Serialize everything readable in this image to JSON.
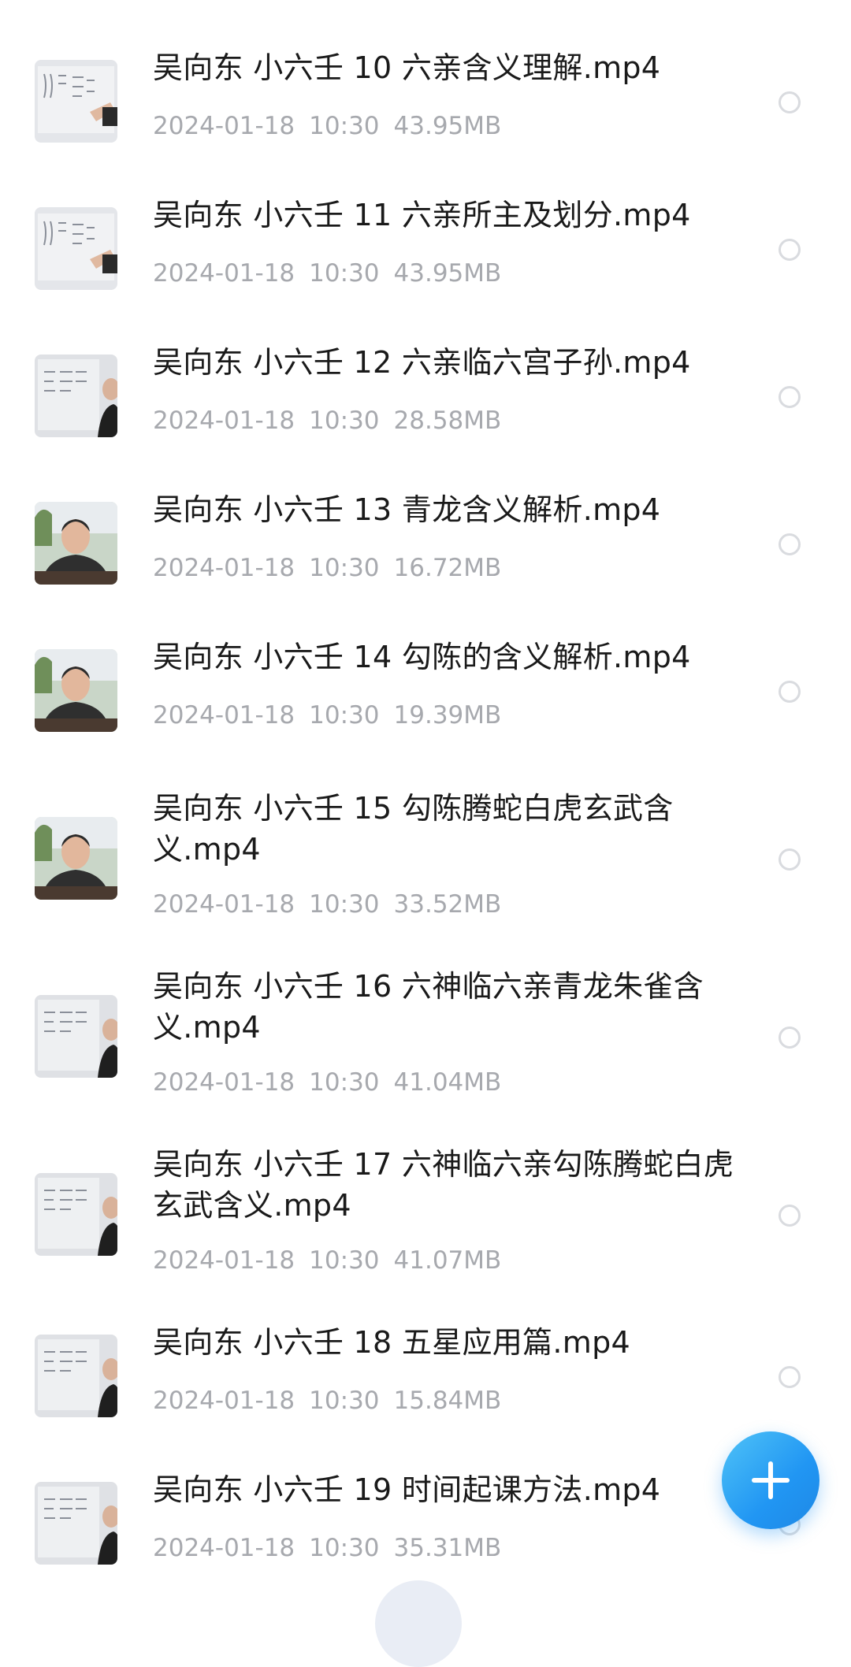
{
  "files": [
    {
      "name": "吴向东 小六壬 10 六亲含义理解.mp4",
      "date": "2024-01-18",
      "time": "10:30",
      "size": "43.95MB",
      "thumb": "whiteboard-hand-icon"
    },
    {
      "name": "吴向东 小六壬 11 六亲所主及划分.mp4",
      "date": "2024-01-18",
      "time": "10:30",
      "size": "43.95MB",
      "thumb": "whiteboard-hand-icon"
    },
    {
      "name": "吴向东 小六壬 12 六亲临六宫子孙.mp4",
      "date": "2024-01-18",
      "time": "10:30",
      "size": "28.58MB",
      "thumb": "whiteboard-person-icon"
    },
    {
      "name": "吴向东 小六壬 13 青龙含义解析.mp4",
      "date": "2024-01-18",
      "time": "10:30",
      "size": "16.72MB",
      "thumb": "presenter-face-icon"
    },
    {
      "name": "吴向东 小六壬 14 勾陈的含义解析.mp4",
      "date": "2024-01-18",
      "time": "10:30",
      "size": "19.39MB",
      "thumb": "presenter-face-icon"
    },
    {
      "name": "吴向东 小六壬 15 勾陈腾蛇白虎玄武含义.mp4",
      "date": "2024-01-18",
      "time": "10:30",
      "size": "33.52MB",
      "thumb": "presenter-face-icon"
    },
    {
      "name": "吴向东 小六壬 16 六神临六亲青龙朱雀含义.mp4",
      "date": "2024-01-18",
      "time": "10:30",
      "size": "41.04MB",
      "thumb": "whiteboard-person-icon"
    },
    {
      "name": "吴向东 小六壬 17 六神临六亲勾陈腾蛇白虎玄武含义.mp4",
      "date": "2024-01-18",
      "time": "10:30",
      "size": "41.07MB",
      "thumb": "whiteboard-person-icon"
    },
    {
      "name": "吴向东 小六壬 18 五星应用篇.mp4",
      "date": "2024-01-18",
      "time": "10:30",
      "size": "15.84MB",
      "thumb": "whiteboard-person-icon"
    },
    {
      "name": "吴向东 小六壬 19 时间起课方法.mp4",
      "date": "2024-01-18",
      "time": "10:30",
      "size": "35.31MB",
      "thumb": "whiteboard-person-icon"
    }
  ],
  "fab": {
    "icon": "plus-icon",
    "color": "#2196f3"
  },
  "colors": {
    "title": "#1a1a1a",
    "meta": "#a7a9ae",
    "radio": "#d9dbdf"
  }
}
